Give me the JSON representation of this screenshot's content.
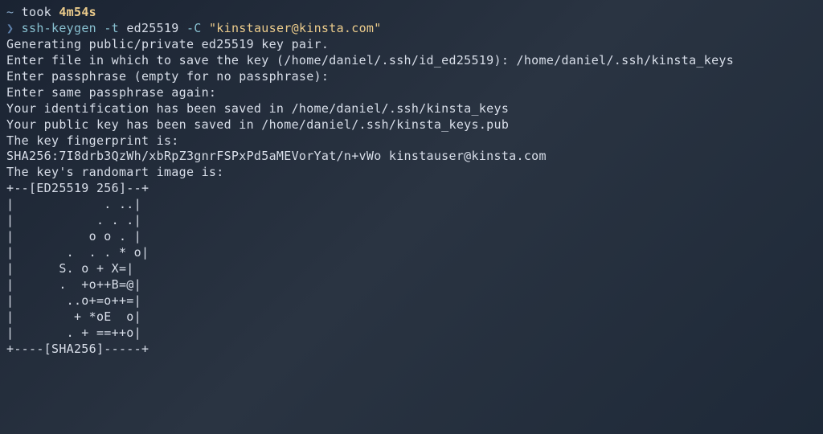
{
  "prompt": {
    "tilde": "~",
    "took_label": " took ",
    "duration": "4m54s",
    "arrow": "❯ ",
    "command": {
      "name": "ssh-keygen",
      "flag1": " -t ",
      "arg1": "ed25519",
      "flag2": " -C ",
      "string": "\"kinstauser@kinsta.com\""
    }
  },
  "output": {
    "line1": "Generating public/private ed25519 key pair.",
    "line2": "Enter file in which to save the key (/home/daniel/.ssh/id_ed25519): /home/daniel/.ssh/kinsta_keys",
    "line3": "Enter passphrase (empty for no passphrase):",
    "line4": "Enter same passphrase again:",
    "line5": "Your identification has been saved in /home/daniel/.ssh/kinsta_keys",
    "line6": "Your public key has been saved in /home/daniel/.ssh/kinsta_keys.pub",
    "line7": "The key fingerprint is:",
    "line8": "SHA256:7I8drb3QzWh/xbRpZ3gnrFSPxPd5aMEVorYat/n+vWo kinstauser@kinsta.com",
    "line9": "The key's randomart image is:",
    "art1": "+--[ED25519 256]--+",
    "art2": "|            . ..|",
    "art3": "|           . . .|",
    "art4": "|          o o . |",
    "art5": "|       .  . . * o|",
    "art6": "|      S. o + X=|",
    "art7": "|      .  +o++B=@|",
    "art8": "|       ..o+=o++=|",
    "art9": "|        + *oE  o|",
    "art10": "|       . + ==++o|",
    "art11": "+----[SHA256]-----+"
  }
}
